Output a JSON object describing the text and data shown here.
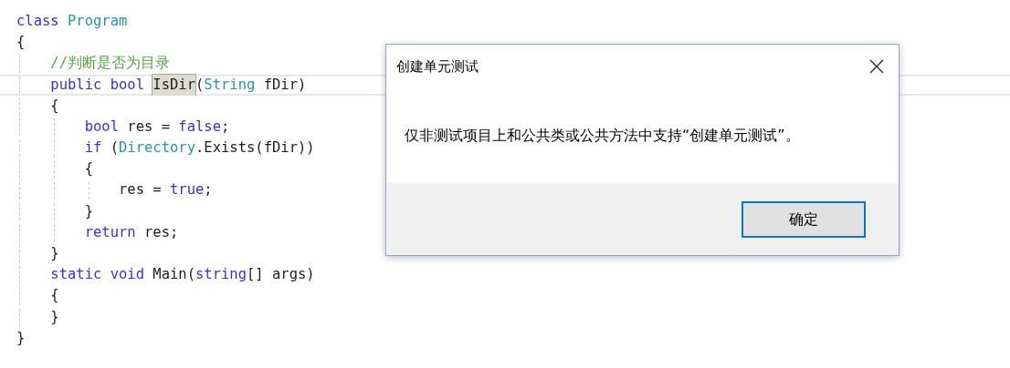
{
  "editor": {
    "lines": [
      {
        "current": false,
        "tokens": [
          {
            "kind": "keyword",
            "text": "class",
            "highlighted": false
          },
          {
            "kind": "type",
            "text": " Program",
            "highlighted": false
          }
        ]
      },
      {
        "current": false,
        "tokens": [
          {
            "kind": "plain",
            "text": "{",
            "highlighted": false
          }
        ]
      },
      {
        "current": false,
        "tokens": [
          {
            "kind": "comment",
            "text": "    //判断是否为目录",
            "highlighted": false
          }
        ]
      },
      {
        "current": true,
        "tokens": [
          {
            "kind": "keyword",
            "text": "    public bool ",
            "highlighted": false
          },
          {
            "kind": "plain",
            "text": "IsDir",
            "highlighted": true
          },
          {
            "kind": "plain",
            "text": "(",
            "highlighted": false
          },
          {
            "kind": "type",
            "text": "String",
            "highlighted": false
          },
          {
            "kind": "plain",
            "text": " fDir)",
            "highlighted": false
          }
        ]
      },
      {
        "current": false,
        "tokens": [
          {
            "kind": "plain",
            "text": "    {",
            "highlighted": false
          }
        ]
      },
      {
        "current": false,
        "tokens": [
          {
            "kind": "keyword",
            "text": "        bool",
            "highlighted": false
          },
          {
            "kind": "plain",
            "text": " res = ",
            "highlighted": false
          },
          {
            "kind": "keyword",
            "text": "false",
            "highlighted": false
          },
          {
            "kind": "plain",
            "text": ";",
            "highlighted": false
          }
        ]
      },
      {
        "current": false,
        "tokens": [
          {
            "kind": "keyword",
            "text": "        if",
            "highlighted": false
          },
          {
            "kind": "plain",
            "text": " (",
            "highlighted": false
          },
          {
            "kind": "type",
            "text": "Directory",
            "highlighted": false
          },
          {
            "kind": "plain",
            "text": ".Exists(fDir))",
            "highlighted": false
          }
        ]
      },
      {
        "current": false,
        "tokens": [
          {
            "kind": "plain",
            "text": "        {",
            "highlighted": false
          }
        ]
      },
      {
        "current": false,
        "tokens": [
          {
            "kind": "plain",
            "text": "            res = ",
            "highlighted": false
          },
          {
            "kind": "keyword",
            "text": "true",
            "highlighted": false
          },
          {
            "kind": "plain",
            "text": ";",
            "highlighted": false
          }
        ]
      },
      {
        "current": false,
        "tokens": [
          {
            "kind": "plain",
            "text": "        }",
            "highlighted": false
          }
        ]
      },
      {
        "current": false,
        "tokens": [
          {
            "kind": "keyword",
            "text": "        return",
            "highlighted": false
          },
          {
            "kind": "plain",
            "text": " res;",
            "highlighted": false
          }
        ]
      },
      {
        "current": false,
        "tokens": [
          {
            "kind": "plain",
            "text": "    }",
            "highlighted": false
          }
        ]
      },
      {
        "current": false,
        "tokens": [
          {
            "kind": "keyword",
            "text": "    static void",
            "highlighted": false
          },
          {
            "kind": "plain",
            "text": " Main(",
            "highlighted": false
          },
          {
            "kind": "keyword",
            "text": "string",
            "highlighted": false
          },
          {
            "kind": "plain",
            "text": "[] args)",
            "highlighted": false
          }
        ]
      },
      {
        "current": false,
        "tokens": [
          {
            "kind": "plain",
            "text": "    {",
            "highlighted": false
          }
        ]
      },
      {
        "current": false,
        "tokens": [
          {
            "kind": "plain",
            "text": "    }",
            "highlighted": false
          }
        ]
      },
      {
        "current": false,
        "tokens": [
          {
            "kind": "plain",
            "text": "}",
            "highlighted": false
          }
        ]
      }
    ]
  },
  "dialog": {
    "title": "创建单元测试",
    "message": "仅非测试项目上和公共类或公共方法中支持“创建单元测试”。",
    "buttons": [
      {
        "label": "确定",
        "selected": true
      }
    ]
  }
}
